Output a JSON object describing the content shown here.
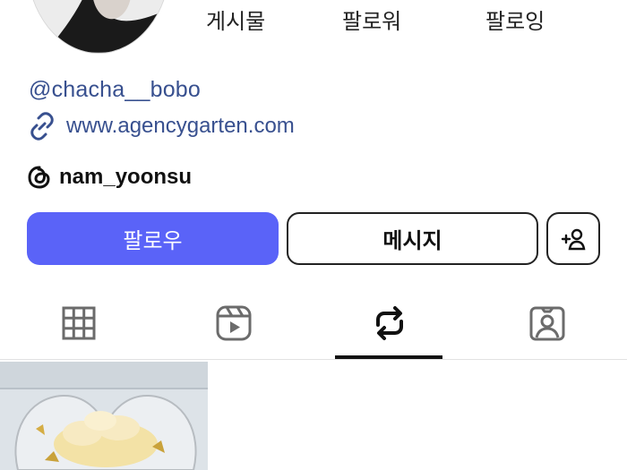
{
  "stats": {
    "posts_label": "게시물",
    "followers_label": "팔로워",
    "following_label": "팔로잉"
  },
  "profile": {
    "username": "@chacha__bobo",
    "link": "www.agencygarten.com",
    "threads_handle": "nam_yoonsu"
  },
  "actions": {
    "follow_label": "팔로우",
    "message_label": "메시지"
  },
  "icons": {
    "link": "link-icon",
    "threads": "threads-icon",
    "add_user": "add-user-icon",
    "grid": "grid-icon",
    "reels": "reels-icon",
    "reposts": "repost-icon",
    "tagged": "tagged-icon"
  },
  "tabs": {
    "active": "reposts"
  },
  "colors": {
    "accent": "#5a63f8",
    "link_text": "#38508f"
  }
}
